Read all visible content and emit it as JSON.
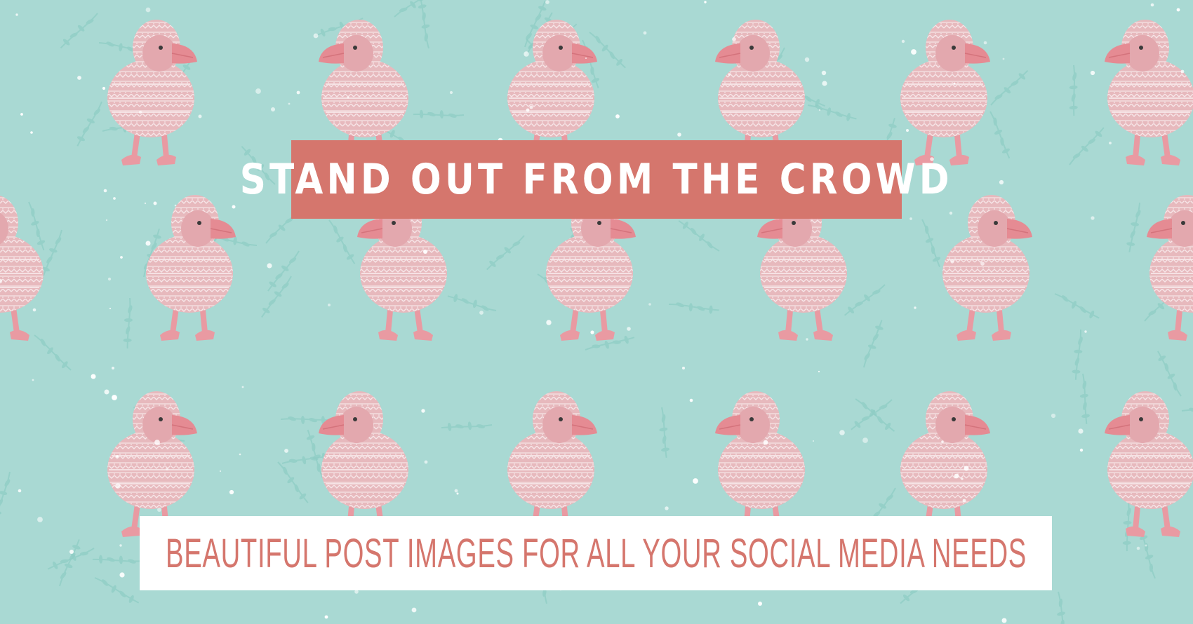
{
  "banner": {
    "headline": "STAND OUT FROM THE CROWD",
    "tagline": "BEAUTIFUL POST IMAGES FOR ALL YOUR SOCIAL MEDIA NEEDS"
  },
  "background": {
    "pattern": "puffin-in-knit-sweater-icon",
    "motif": "leafy-branch-icon",
    "colors": {
      "background": "#a9d9d3",
      "foliage": "#8ccbc3",
      "puffin_pink": "#e3a8ae",
      "sweater_pattern": "#f6e4e7",
      "feet": "#e99aa2",
      "beak": "#e58b93"
    }
  },
  "colors": {
    "headline_box": "#d5766d",
    "headline_text": "#ffffff",
    "tagline_box": "#ffffff",
    "tagline_text": "#d5766d"
  }
}
